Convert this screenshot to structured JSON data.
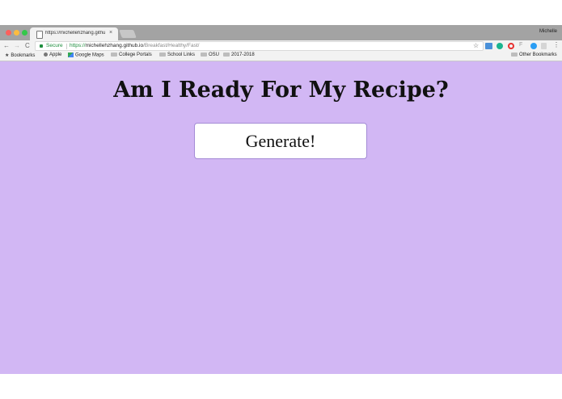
{
  "browser": {
    "tab_title": "https://michellehzhang.githu",
    "profile_name": "Michelle",
    "secure_label": "Secure",
    "url_scheme": "https://",
    "url_host": "michellehzhang.github.io",
    "url_path": "/Breakfast/Healthy/Fast/",
    "bookmarks": [
      {
        "label": "Bookmarks",
        "icon": "star-icon"
      },
      {
        "label": "Apple",
        "icon": "apple-icon"
      },
      {
        "label": "Google Maps",
        "icon": "maps-icon"
      },
      {
        "label": "College Portals",
        "icon": "folder-icon"
      },
      {
        "label": "School Links",
        "icon": "folder-icon"
      },
      {
        "label": "OSU",
        "icon": "folder-icon"
      },
      {
        "label": "2017-2018",
        "icon": "folder-icon"
      }
    ],
    "other_bookmarks": "Other Bookmarks"
  },
  "page": {
    "title": "Am I Ready For My Recipe?",
    "generate_label": "Generate!",
    "background_color": "#d2b7f4"
  }
}
